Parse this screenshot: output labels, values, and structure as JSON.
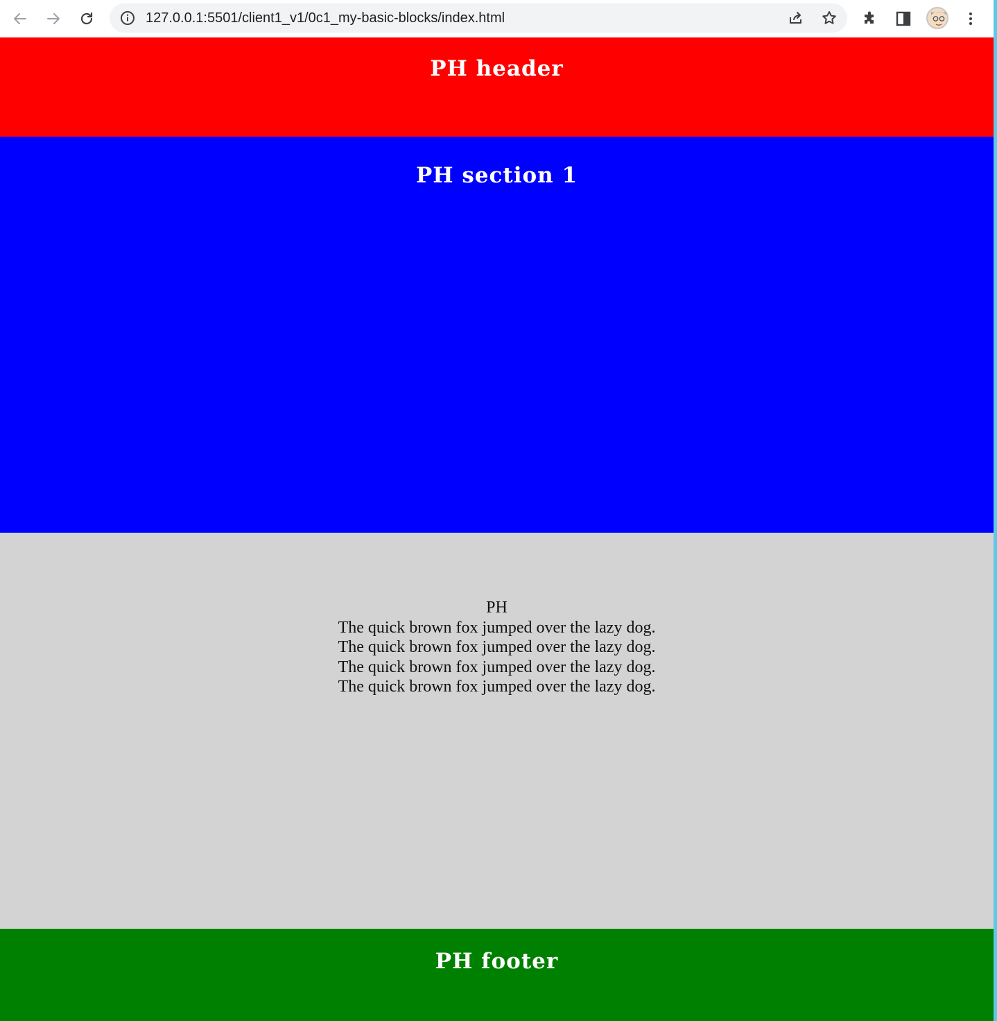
{
  "browser": {
    "url": "127.0.0.1:5501/client1_v1/0c1_my-basic-blocks/index.html",
    "icons": {
      "back": "arrow-left-icon",
      "forward": "arrow-right-icon",
      "reload": "reload-icon",
      "site_info": "info-icon",
      "share": "share-icon",
      "bookmark": "star-icon",
      "extensions": "puzzle-icon",
      "side_panel": "side-panel-icon",
      "profile": "avatar",
      "menu": "kebab-menu-icon"
    }
  },
  "page": {
    "header": {
      "title": "PH header",
      "color": "#ff0000"
    },
    "section1": {
      "title": "PH section 1",
      "color": "#0000ff"
    },
    "section2": {
      "color": "#d3d3d3",
      "lines": [
        "PH",
        "The quick brown fox jumped over the lazy dog.",
        "The quick brown fox jumped over the lazy dog.",
        "The quick brown fox jumped over the lazy dog.",
        "The quick brown fox jumped over the lazy dog."
      ]
    },
    "footer": {
      "title": "PH footer",
      "color": "#008000"
    }
  }
}
